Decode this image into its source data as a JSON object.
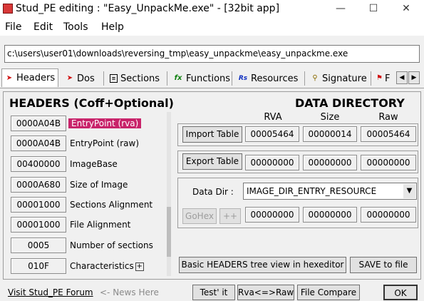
{
  "window": {
    "title": "Stud_PE editing : \"Easy_UnpackMe.exe\" - [32bit app]",
    "minimize": "—",
    "maximize": "☐",
    "close": "✕"
  },
  "menu": {
    "file": "File",
    "edit": "Edit",
    "tools": "Tools",
    "help": "Help"
  },
  "path": "c:\\users\\user01\\downloads\\reversing_tmp\\easy_unpackme\\easy_unpackme.exe",
  "tabs": {
    "headers": "Headers",
    "dos": "Dos",
    "sections": "Sections",
    "functions": "Functions",
    "resources": "Resources",
    "signature": "Signature",
    "more": "F",
    "functions_icon": "fx",
    "resources_icon": "Rs"
  },
  "headers": {
    "title": "HEADERS (Coff+Optional)",
    "rows": [
      {
        "value": "0000A04B",
        "label": "EntryPoint (rva)"
      },
      {
        "value": "0000A04B",
        "label": "EntryPoint (raw)"
      },
      {
        "value": "00400000",
        "label": "ImageBase"
      },
      {
        "value": "0000A680",
        "label": "Size of Image"
      },
      {
        "value": "00001000",
        "label": "Sections Alignment"
      },
      {
        "value": "00001000",
        "label": "File Alignment"
      },
      {
        "value": "0005",
        "label": "Number of sections"
      },
      {
        "value": "010F",
        "label": "Characteristics"
      }
    ],
    "expand": "+"
  },
  "datadir": {
    "title": "DATA  DIRECTORY",
    "col_rva": "RVA",
    "col_size": "Size",
    "col_raw": "Raw",
    "import": {
      "label": "Import Table",
      "rva": "00005464",
      "size": "00000014",
      "raw": "00005464"
    },
    "export": {
      "label": "Export Table",
      "rva": "00000000",
      "size": "00000000",
      "raw": "00000000"
    },
    "dir_label": "Data Dir :",
    "dir_selected": "IMAGE_DIR_ENTRY_RESOURCE",
    "gohex": "GoHex",
    "plusplus": "++",
    "dir_rva": "00000000",
    "dir_size": "00000000",
    "dir_raw": "00000000"
  },
  "actions": {
    "tree_view": "Basic HEADERS tree view in hexeditor",
    "save": "SAVE to file"
  },
  "bottom": {
    "forum": "Visit Stud_PE Forum",
    "news": "<- News Here",
    "test": "Test' it",
    "rva_raw": "Rva<=>Raw",
    "compare": "File Compare",
    "ok": "OK"
  },
  "colors": {
    "highlight": "#c8236a",
    "tab_icon_red": "#d01010"
  }
}
